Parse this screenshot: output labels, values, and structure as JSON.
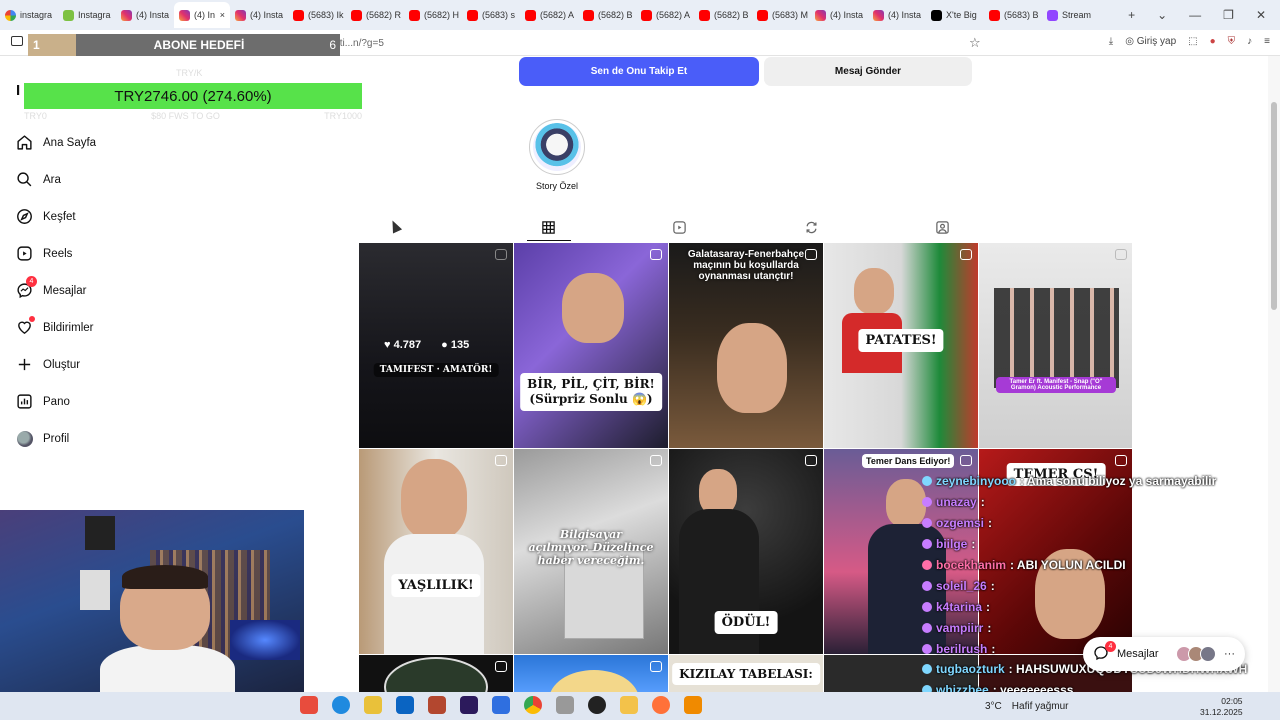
{
  "browser": {
    "tabs": [
      {
        "label": "instagra",
        "icon": "google-icon"
      },
      {
        "label": "Instagra",
        "icon": "green-icon"
      },
      {
        "label": "(4) Insta",
        "icon": "instagram-icon"
      },
      {
        "label": "(4) In",
        "icon": "instagram-icon",
        "active": true
      },
      {
        "label": "(4) Insta",
        "icon": "instagram-icon"
      },
      {
        "label": "(5683) Ik",
        "icon": "youtube-icon"
      },
      {
        "label": "(5682) R",
        "icon": "youtube-icon"
      },
      {
        "label": "(5682) H",
        "icon": "youtube-icon"
      },
      {
        "label": "(5683) s",
        "icon": "youtube-icon"
      },
      {
        "label": "(5682) A",
        "icon": "youtube-icon"
      },
      {
        "label": "(5682) B",
        "icon": "youtube-icon"
      },
      {
        "label": "(5682) A",
        "icon": "youtube-icon"
      },
      {
        "label": "(5682) B",
        "icon": "youtube-icon"
      },
      {
        "label": "(5683) M",
        "icon": "youtube-icon"
      },
      {
        "label": "(4) Insta",
        "icon": "instagram-icon"
      },
      {
        "label": "(4) Insta",
        "icon": "instagram-icon"
      },
      {
        "label": "X'te Big",
        "icon": "x-icon"
      },
      {
        "label": "(5683) B",
        "icon": "youtube-icon"
      },
      {
        "label": "Stream",
        "icon": "twitch-icon"
      }
    ],
    "close_tab": "×",
    "new_tab": "+",
    "url": "www.instagram.com/tamfti...n/?g=5",
    "signin": "Giriş yap"
  },
  "overlays": {
    "abone_left": "1",
    "abone_label": "ABONE HEDEFİ",
    "abone_right": "6",
    "ticker_value": "TRY2746.00 (274.60%)",
    "ticker_top": "TRY/K",
    "ticker_left": "TRY0",
    "ticker_mid": "$80 FWS TO GO",
    "ticker_right": "TRY1000"
  },
  "sidebar": {
    "items": [
      {
        "label": "Ana Sayfa",
        "icon": "home-icon"
      },
      {
        "label": "Ara",
        "icon": "search-icon"
      },
      {
        "label": "Keşfet",
        "icon": "compass-icon"
      },
      {
        "label": "Reels",
        "icon": "reels-icon"
      },
      {
        "label": "Mesajlar",
        "icon": "messenger-icon",
        "badge": "4"
      },
      {
        "label": "Bildirimler",
        "icon": "heart-icon"
      },
      {
        "label": "Oluştur",
        "icon": "plus-icon"
      },
      {
        "label": "Pano",
        "icon": "dashboard-icon"
      },
      {
        "label": "Profil",
        "icon": "avatar"
      }
    ]
  },
  "profile": {
    "follow_back": "Sen de Onu Takip Et",
    "message": "Mesaj Gönder",
    "highlight_label": "Story Özel",
    "accent": "#4a5df9"
  },
  "posts": {
    "p1_likes": "4.787",
    "p1_comments": "135",
    "p1_caption": "TAMIFEST · AMATÖR!",
    "p2_caption_a": "BİR, PİL, ÇİT, BİR!",
    "p2_caption_b": "(Sürpriz Sonlu 😱)",
    "p3_caption": "Galatasaray-Fenerbahçe maçının bu koşullarda oynanması utançtır!",
    "p4_caption": "PATATES!",
    "p5_caption": "Tamer Er ft. Manifest - Snap (\"O\" Gramon) Acoustic Performance",
    "p6_caption": "YAŞLILIK!",
    "p7_caption": "Bilgisayar açılmıyor. Düzelince haber vereceğim.",
    "p8_caption": "ÖDÜL!",
    "p9_caption": "Temer Dans Ediyor!",
    "p10_caption": "TEMER CS!",
    "p13_caption": "KIZILAY TABELASI:"
  },
  "chat": [
    {
      "user": "zeynebinyooo",
      "color": "#7fd7ff",
      "text": ": Ama sonu biliyoz ya sarmayabilir"
    },
    {
      "user": "unazay",
      "color": "#c77dff",
      "text": ":"
    },
    {
      "user": "ozgemsi",
      "color": "#c77dff",
      "text": ":"
    },
    {
      "user": "biilge",
      "color": "#c77dff",
      "text": ":"
    },
    {
      "user": "bocekhanim",
      "color": "#ff6fa8",
      "text": ": ABI YOLUN ACILDI"
    },
    {
      "user": "soleil_26",
      "color": "#c77dff",
      "text": ":"
    },
    {
      "user": "k4tarina",
      "color": "#c77dff",
      "text": ":"
    },
    {
      "user": "vampiirr",
      "color": "#c77dff",
      "text": ":"
    },
    {
      "user": "berilrush",
      "color": "#c77dff",
      "text": ":"
    },
    {
      "user": "tugbaozturk",
      "color": "#7fd7ff",
      "text": ": HAHSUWUXUQUDYSUDJWHDHWHXWH"
    },
    {
      "user": "whizzbee",
      "color": "#7fd7ff",
      "text": ": yeeeeeeesss"
    }
  ],
  "messages_float": {
    "label": "Mesajlar",
    "badge": "4"
  },
  "taskbar": {
    "weather": "3°C",
    "weather_desc": "Hafif yağmur",
    "time": "02:05",
    "date": "31.12.2025"
  }
}
